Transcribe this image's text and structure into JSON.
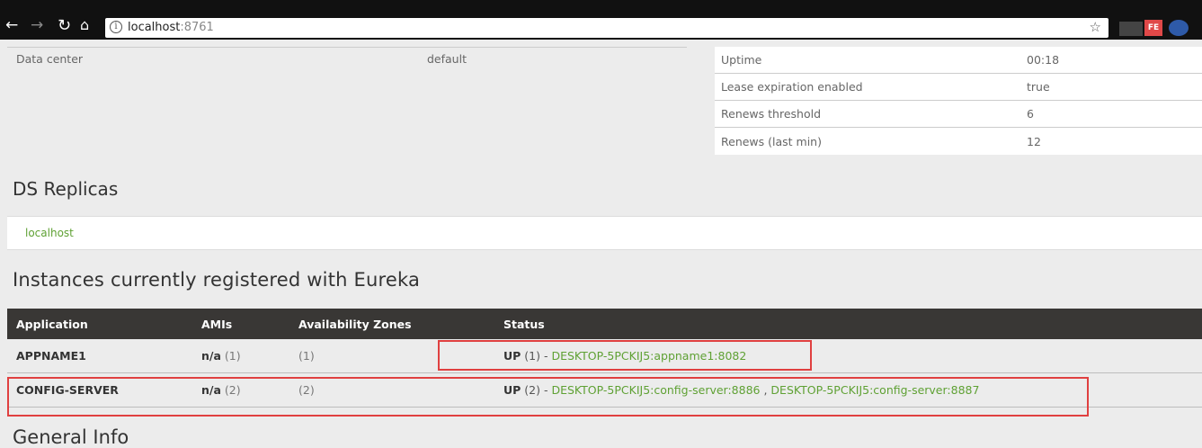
{
  "browser": {
    "url_host": "localhost",
    "url_port": ":8761"
  },
  "extensions": {
    "ext2_label": "FE"
  },
  "system_status": {
    "left": [
      {
        "key": "Data center",
        "value": "default"
      }
    ],
    "right": [
      {
        "key": "Uptime",
        "value": "00:18"
      },
      {
        "key": "Lease expiration enabled",
        "value": "true"
      },
      {
        "key": "Renews threshold",
        "value": "6"
      },
      {
        "key": "Renews (last min)",
        "value": "12"
      }
    ]
  },
  "ds_replicas": {
    "title": "DS Replicas",
    "items": [
      "localhost"
    ]
  },
  "instances": {
    "title": "Instances currently registered with Eureka",
    "headers": [
      "Application",
      "AMIs",
      "Availability Zones",
      "Status"
    ],
    "rows": [
      {
        "application": "APPNAME1",
        "ami": "n/a",
        "ami_count": "(1)",
        "zones": "(1)",
        "status": "UP",
        "status_count": "(1) - ",
        "links": [
          "DESKTOP-5PCKIJ5:appname1:8082"
        ]
      },
      {
        "application": "CONFIG-SERVER",
        "ami": "n/a",
        "ami_count": "(2)",
        "zones": "(2)",
        "status": "UP",
        "status_count": "(2) - ",
        "links": [
          "DESKTOP-5PCKIJ5:config-server:8886",
          "DESKTOP-5PCKIJ5:config-server:8887"
        ],
        "link_separator": " , "
      }
    ]
  },
  "general_info": {
    "title": "General Info"
  }
}
